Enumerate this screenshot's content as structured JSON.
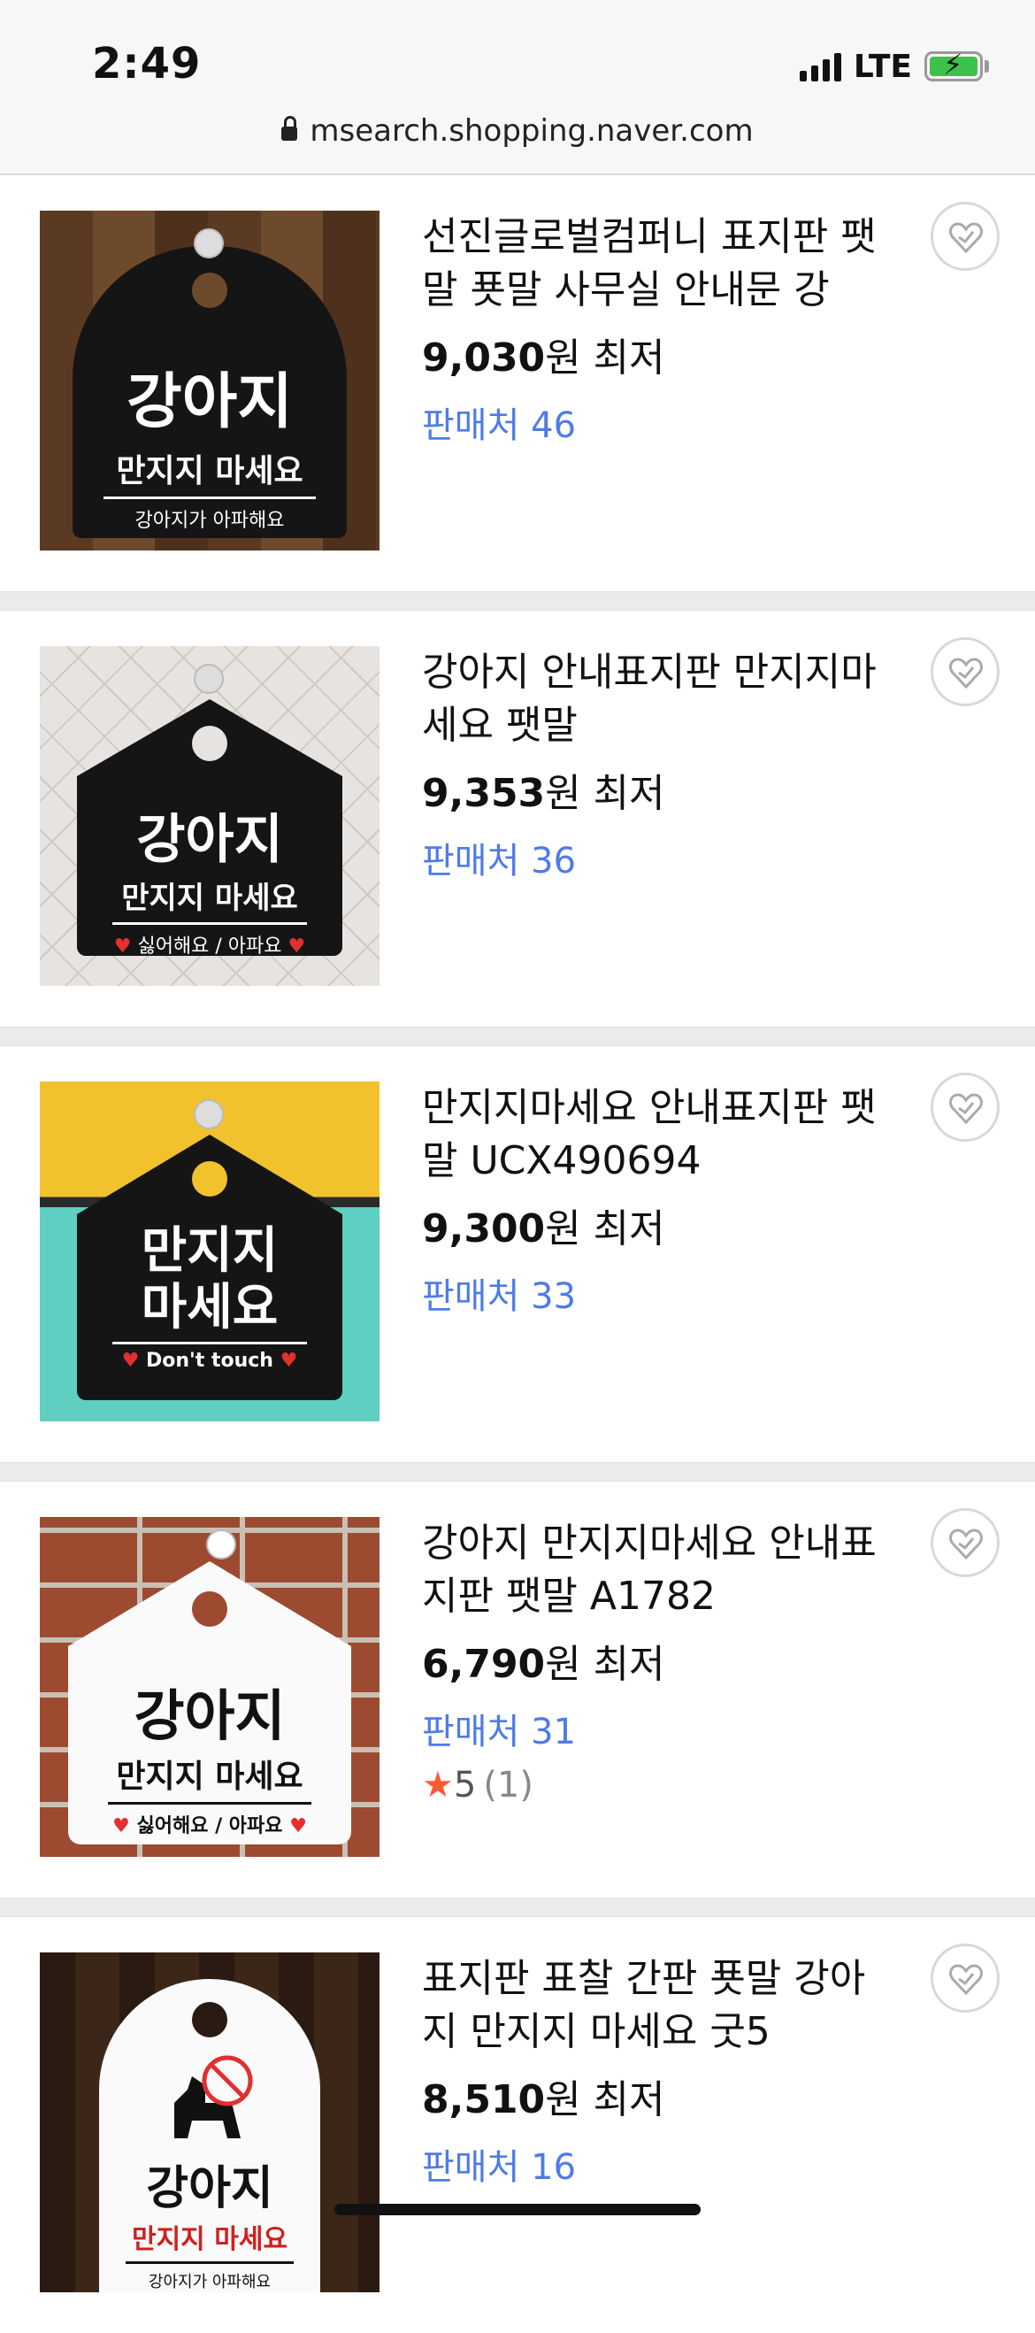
{
  "status_bar": {
    "time": "2:49",
    "network": "LTE"
  },
  "address_bar": {
    "url": "msearch.shopping.naver.com"
  },
  "products": [
    {
      "title": "선진글로벌컴퍼니 표지판 팻말 푯말 사무실 안내문 강아...",
      "price_value": "9,030",
      "price_suffix": "원 최저",
      "sellers": "판매처 46",
      "image_text": [
        "강아지",
        "만지지 마세요",
        "강아지가 아파해요"
      ]
    },
    {
      "title": "강아지 안내표지판 만지지마세요 팻말",
      "price_value": "9,353",
      "price_suffix": "원 최저",
      "sellers": "판매처 36",
      "image_text": [
        "강아지",
        "만지지 마세요",
        "싫어해요 / 아파요"
      ]
    },
    {
      "title": "만지지마세요 안내표지판 팻말 UCX490694",
      "price_value": "9,300",
      "price_suffix": "원 최저",
      "sellers": "판매처 33",
      "image_text": [
        "만지지",
        "마세요",
        "Don't touch"
      ]
    },
    {
      "title": "강아지 만지지마세요 안내표지판 팻말 A1782",
      "price_value": "6,790",
      "price_suffix": "원 최저",
      "sellers": "판매처 31",
      "rating_star": "★",
      "rating_value": "5",
      "rating_count": "(1)",
      "image_text": [
        "강아지",
        "만지지 마세요",
        "싫어해요 / 아파요"
      ]
    },
    {
      "title": "표지판 표찰 간판 푯말 강아지 만지지 마세요 굿5",
      "price_value": "8,510",
      "price_suffix": "원 최저",
      "sellers": "판매처 16",
      "image_text": [
        "강아지",
        "만지지 마세요",
        "강아지가 아파해요"
      ]
    }
  ],
  "colors": {
    "seller_link": "#4f7be8",
    "rating_star": "#ff5a36",
    "separator": "#ebebeb"
  },
  "icons": [
    "lock-icon",
    "signal-icon",
    "battery-icon",
    "wishlist-heart-icon",
    "star-icon"
  ]
}
